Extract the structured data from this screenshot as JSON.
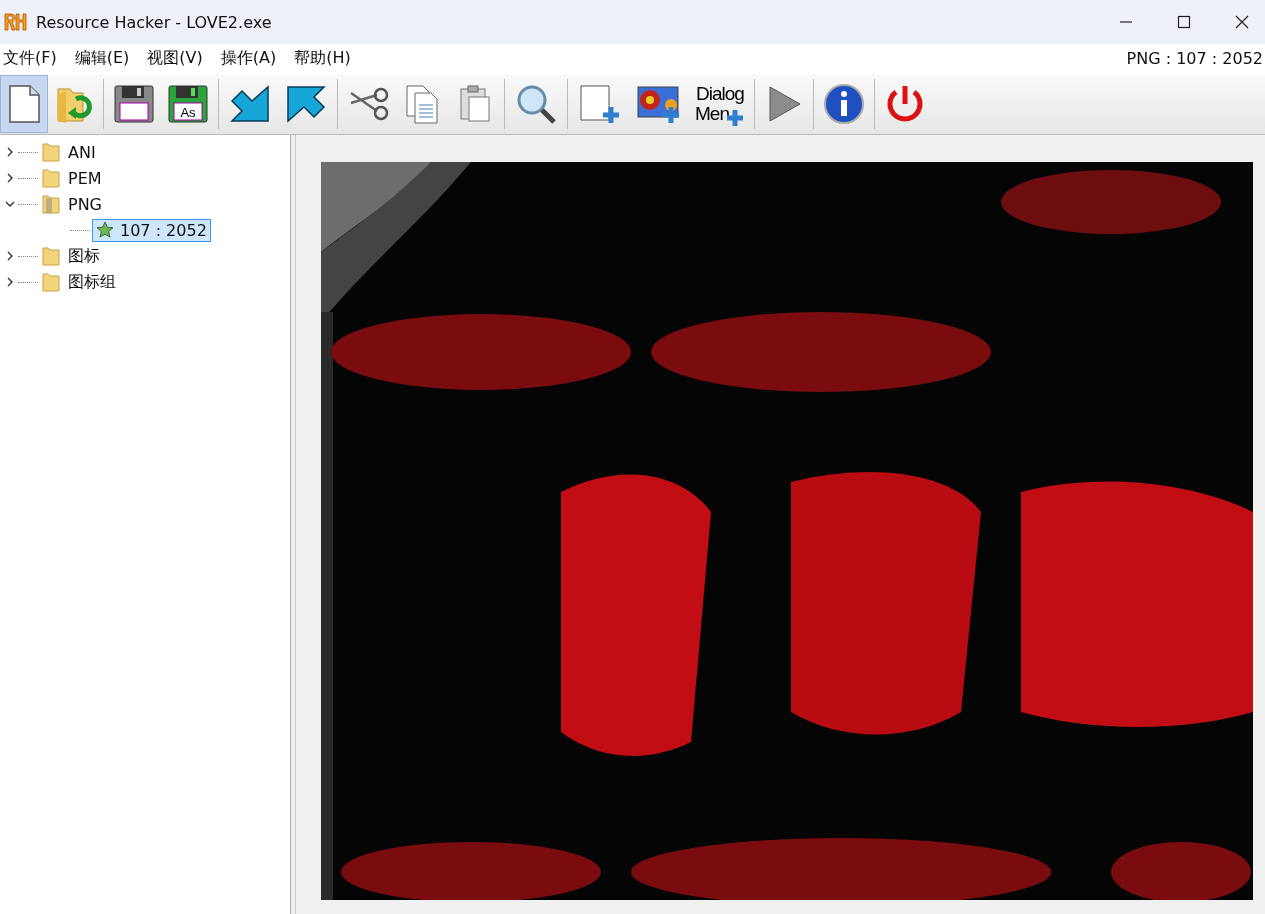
{
  "window": {
    "title": "Resource Hacker - LOVE2.exe"
  },
  "menu": [
    "文件(F)",
    "编辑(E)",
    "视图(V)",
    "操作(A)",
    "帮助(H)"
  ],
  "status": "PNG : 107 : 2052",
  "toolbar": [
    {
      "kind": "new",
      "selected": true
    },
    {
      "kind": "open",
      "selected": false
    },
    {
      "kind": "separator"
    },
    {
      "kind": "save",
      "selected": false
    },
    {
      "kind": "save-as",
      "label": "As",
      "selected": false
    },
    {
      "kind": "separator"
    },
    {
      "kind": "arrow-in",
      "selected": false
    },
    {
      "kind": "arrow-out",
      "selected": false
    },
    {
      "kind": "separator"
    },
    {
      "kind": "cut",
      "selected": false
    },
    {
      "kind": "copy",
      "selected": false
    },
    {
      "kind": "paste",
      "selected": false
    },
    {
      "kind": "separator"
    },
    {
      "kind": "find",
      "selected": false
    },
    {
      "kind": "separator"
    },
    {
      "kind": "add-blank",
      "selected": false
    },
    {
      "kind": "add-image",
      "selected": false
    },
    {
      "kind": "add-dialog",
      "label": "Dialog",
      "label2": "Men",
      "selected": false
    },
    {
      "kind": "separator"
    },
    {
      "kind": "run",
      "selected": false
    },
    {
      "kind": "separator"
    },
    {
      "kind": "info",
      "selected": false
    },
    {
      "kind": "separator"
    },
    {
      "kind": "exit",
      "selected": false
    }
  ],
  "tree": [
    {
      "label": "ANI",
      "expanded": false
    },
    {
      "label": "PEM",
      "expanded": false
    },
    {
      "label": "PNG",
      "expanded": true,
      "children": [
        {
          "label": "107 : 2052",
          "selected": true
        }
      ]
    },
    {
      "label": "图标",
      "expanded": false
    },
    {
      "label": "图标组",
      "expanded": false
    }
  ]
}
